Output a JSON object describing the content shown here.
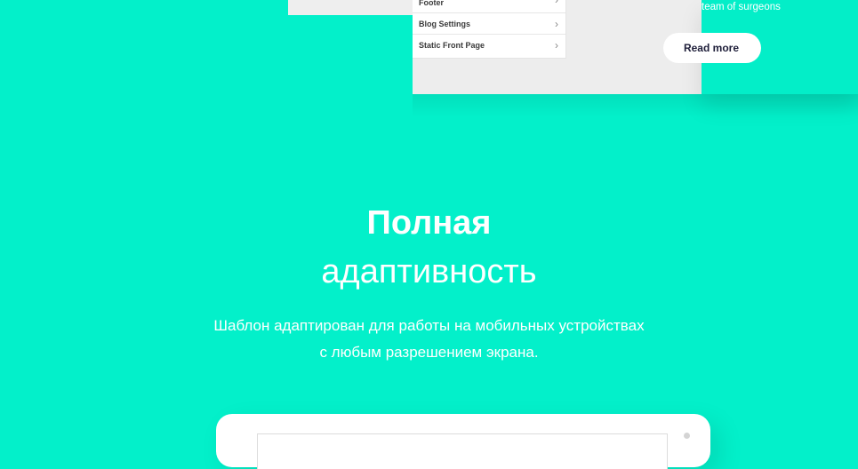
{
  "customizer_menu": {
    "items": [
      {
        "label": "Footer"
      },
      {
        "label": "Blog Settings"
      },
      {
        "label": "Static Front Page"
      }
    ]
  },
  "preview": {
    "caption": "team of surgeons",
    "button_label": "Read more"
  },
  "feature": {
    "title_line1": "Полная",
    "title_line2": "адаптивность",
    "desc_line1": "Шаблон адаптирован для работы на мобильных устройствах",
    "desc_line2": "с любым разрешением экрана."
  },
  "icons": {
    "chevron": "chevron-right-icon"
  },
  "colors": {
    "background": "#03f0ca",
    "text": "#ffffff"
  }
}
